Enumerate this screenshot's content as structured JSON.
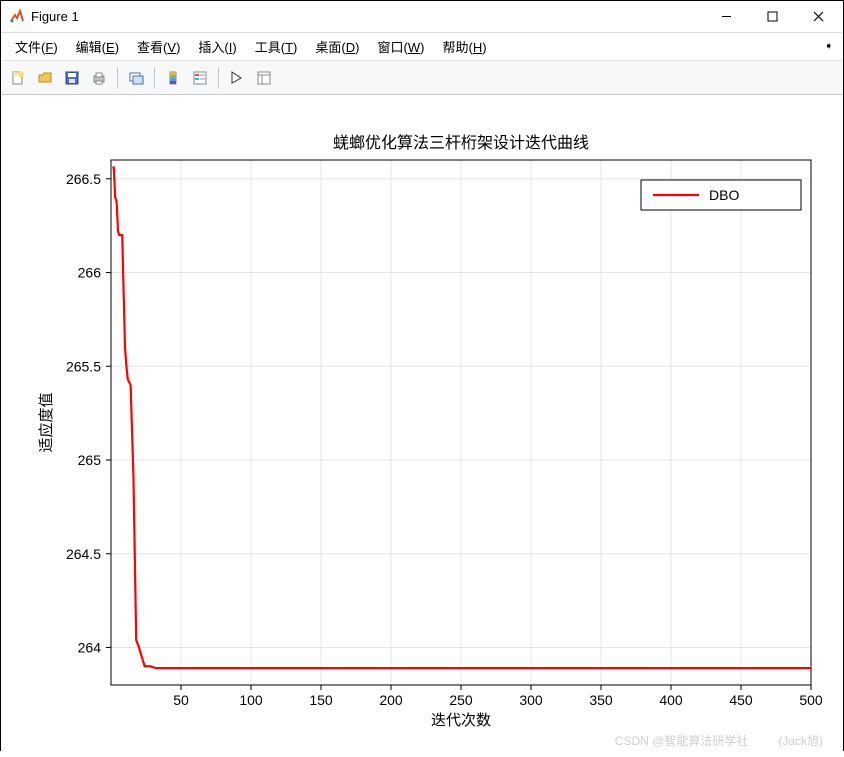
{
  "window": {
    "title": "Figure 1"
  },
  "menu": {
    "items": [
      {
        "label": "文件",
        "hotkey": "F"
      },
      {
        "label": "编辑",
        "hotkey": "E"
      },
      {
        "label": "查看",
        "hotkey": "V"
      },
      {
        "label": "插入",
        "hotkey": "I"
      },
      {
        "label": "工具",
        "hotkey": "T"
      },
      {
        "label": "桌面",
        "hotkey": "D"
      },
      {
        "label": "窗口",
        "hotkey": "W"
      },
      {
        "label": "帮助",
        "hotkey": "H"
      }
    ]
  },
  "legend": {
    "label": "DBO"
  },
  "watermark": {
    "left": "CSDN @智能算法研学社",
    "right": "(Jack旭)"
  },
  "chart_data": {
    "type": "line",
    "title": "蜣螂优化算法三杆桁架设计迭代曲线",
    "xlabel": "迭代次数",
    "ylabel": "适应度值",
    "xlim": [
      0,
      500
    ],
    "ylim": [
      263.8,
      266.6
    ],
    "xticks": [
      50,
      100,
      150,
      200,
      250,
      300,
      350,
      400,
      450,
      500
    ],
    "yticks": [
      264,
      264.5,
      265,
      265.5,
      266,
      266.5
    ],
    "series": [
      {
        "name": "DBO",
        "color": "#ff0000",
        "x": [
          1,
          2,
          3,
          4,
          5,
          6,
          8,
          10,
          11,
          12,
          14,
          16,
          18,
          20,
          24,
          28,
          32,
          36,
          40,
          50,
          500
        ],
        "values": [
          266.56,
          266.56,
          266.4,
          266.38,
          266.22,
          266.2,
          266.2,
          265.6,
          265.5,
          265.43,
          265.4,
          264.92,
          264.04,
          264.0,
          263.9,
          263.9,
          263.89,
          263.89,
          263.89,
          263.89,
          263.89
        ]
      }
    ]
  }
}
